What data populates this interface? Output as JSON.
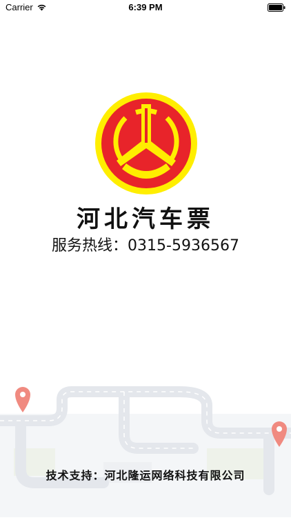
{
  "status_bar": {
    "carrier": "Carrier",
    "time": "6:39 PM"
  },
  "splash": {
    "app_title": "河北汽车票",
    "hotline": "服务热线：0315-5936567",
    "footer": "技术支持：河北隆运网络科技有限公司"
  },
  "colors": {
    "logo_red": "#e8242a",
    "logo_yellow": "#ffee00",
    "map_road": "#e4e7ec",
    "map_pin": "#f08a80"
  }
}
